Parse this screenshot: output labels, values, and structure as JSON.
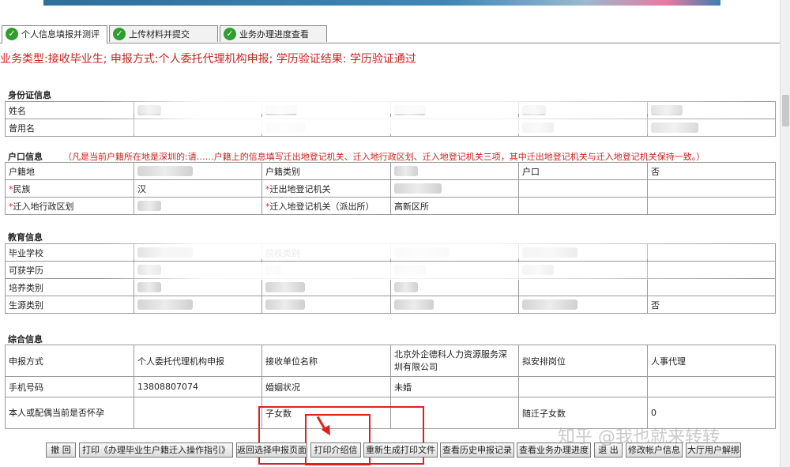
{
  "tabs": [
    "个人信息填报并测评",
    "上传材料并提交",
    "业务办理进度查看"
  ],
  "summary": "业务类型:接收毕业生; 申报方式:个人委托代理机构申报;  学历验证结果:  学历验证通过",
  "id_section": {
    "title": "身份证信息",
    "rows": [
      "姓名",
      "曾用名"
    ]
  },
  "hukou_section": {
    "title": "户口信息",
    "note": "（凡是当前户籍所在地是深圳的:请……户籍上的信息填写迁出地登记机关、迁入地行政区划、迁入地登记机关三项，其中迁出地登记机关与迁入地登记机关保持一致。）",
    "r1": {
      "a": "户籍地",
      "b": "户籍类别",
      "c": "户口",
      "d": "否"
    },
    "r2": {
      "a": "民族",
      "a_val": "汉",
      "b": "迁出地登记机关"
    },
    "r3": {
      "a": "迁入地行政区划",
      "b": "迁入地登记机关（派出所）",
      "b_val": "高新区所"
    }
  },
  "edu_section": {
    "title": "教育信息",
    "r1": {
      "a": "毕业学校",
      "b": "院校类别"
    },
    "r2": {
      "a": "可获学历"
    },
    "r3": {
      "a": "培养类别"
    },
    "r4": {
      "a": "生源类别",
      "d": "否"
    }
  },
  "misc_section": {
    "title": "综合信息",
    "r1": {
      "a": "申报方式",
      "a_val": "个人委托代理机构申报",
      "b": "接收单位名称",
      "b_val": "北京外企德科人力资源服务深圳有限公司",
      "c": "拟安排岗位",
      "c_val": "人事代理"
    },
    "r2": {
      "a": "手机号码",
      "a_val": "13808807074",
      "b": "婚姻状况",
      "b_val": "未婚"
    },
    "r3": {
      "a": "本人或配偶当前是否怀孕",
      "b": "子女数",
      "c": "随迁子女数",
      "c_val": "0"
    }
  },
  "buttons": [
    "撤 回",
    "打印《办理毕业生户籍迁入操作指引》",
    "返回选择申报页面",
    "打印介绍信",
    "重新生成打印文件",
    "查看历史申报记录",
    "查看业务办理进度",
    "退 出",
    "修改帐户信息",
    "大厅用户解绑"
  ],
  "watermark": "知乎 @我也就来转转",
  "colors": {
    "accent_red": "#c8241f",
    "check_green": "#2f9e2f"
  }
}
